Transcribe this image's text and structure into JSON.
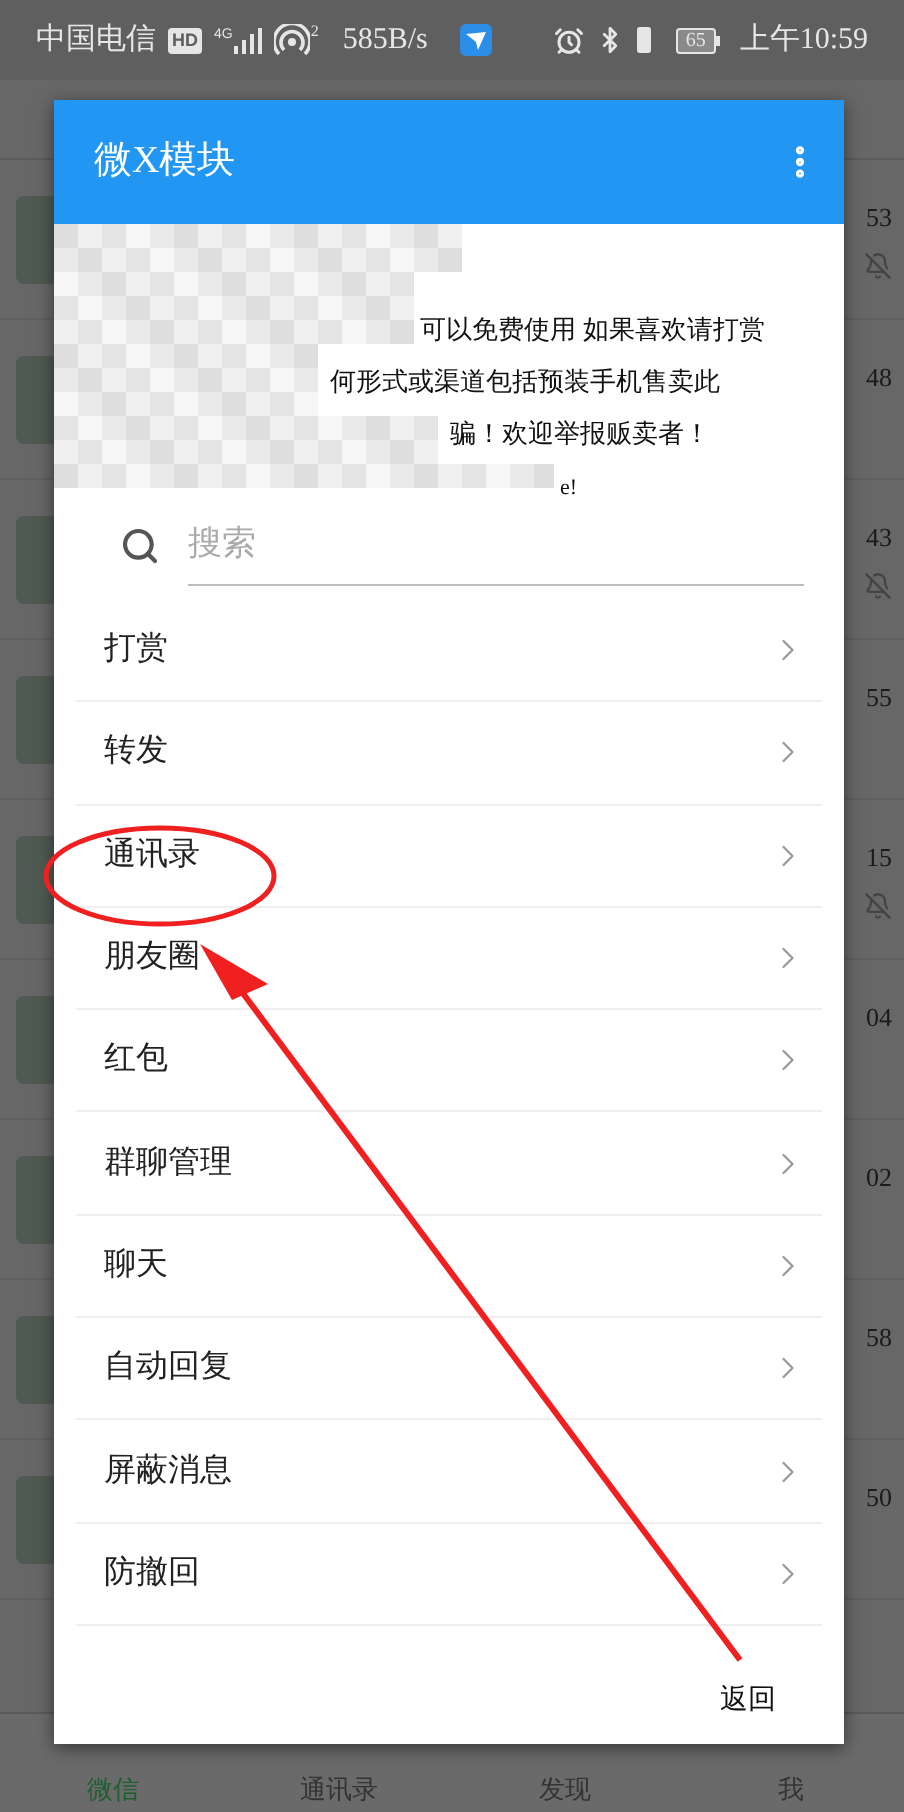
{
  "status_bar": {
    "carrier": "中国电信",
    "hd": "HD",
    "network": "4G",
    "hotspot_count": "2",
    "speed": "585B/s",
    "battery": "65",
    "time": "上午10:59"
  },
  "background_app": {
    "rows": [
      {
        "time": "53",
        "muted": true
      },
      {
        "time": "48",
        "muted": false
      },
      {
        "time": "43",
        "muted": true
      },
      {
        "time": "55",
        "muted": false
      },
      {
        "time": "15",
        "muted": true
      },
      {
        "time": "04",
        "muted": false
      },
      {
        "time": "02",
        "muted": false
      },
      {
        "time": "58",
        "muted": false
      },
      {
        "time": "50",
        "muted": false
      }
    ],
    "tabs": [
      {
        "label": "微信",
        "selected": true
      },
      {
        "label": "通讯录",
        "selected": false
      },
      {
        "label": "发现",
        "selected": false
      },
      {
        "label": "我",
        "selected": false
      }
    ]
  },
  "dialog": {
    "title": "微X模块",
    "notice_lines": [
      "可以免费使用 如果喜欢请打赏",
      "何形式或渠道包括预装手机售卖此",
      "骗！欢迎举报贩卖者！",
      "e!"
    ],
    "search": {
      "placeholder": "搜索"
    },
    "items": [
      {
        "label": "打赏"
      },
      {
        "label": "转发"
      },
      {
        "label": "通讯录"
      },
      {
        "label": "朋友圈"
      },
      {
        "label": "红包"
      },
      {
        "label": "群聊管理"
      },
      {
        "label": "聊天"
      },
      {
        "label": "自动回复"
      },
      {
        "label": "屏蔽消息"
      },
      {
        "label": "防撤回"
      }
    ],
    "back_button": "返回"
  }
}
